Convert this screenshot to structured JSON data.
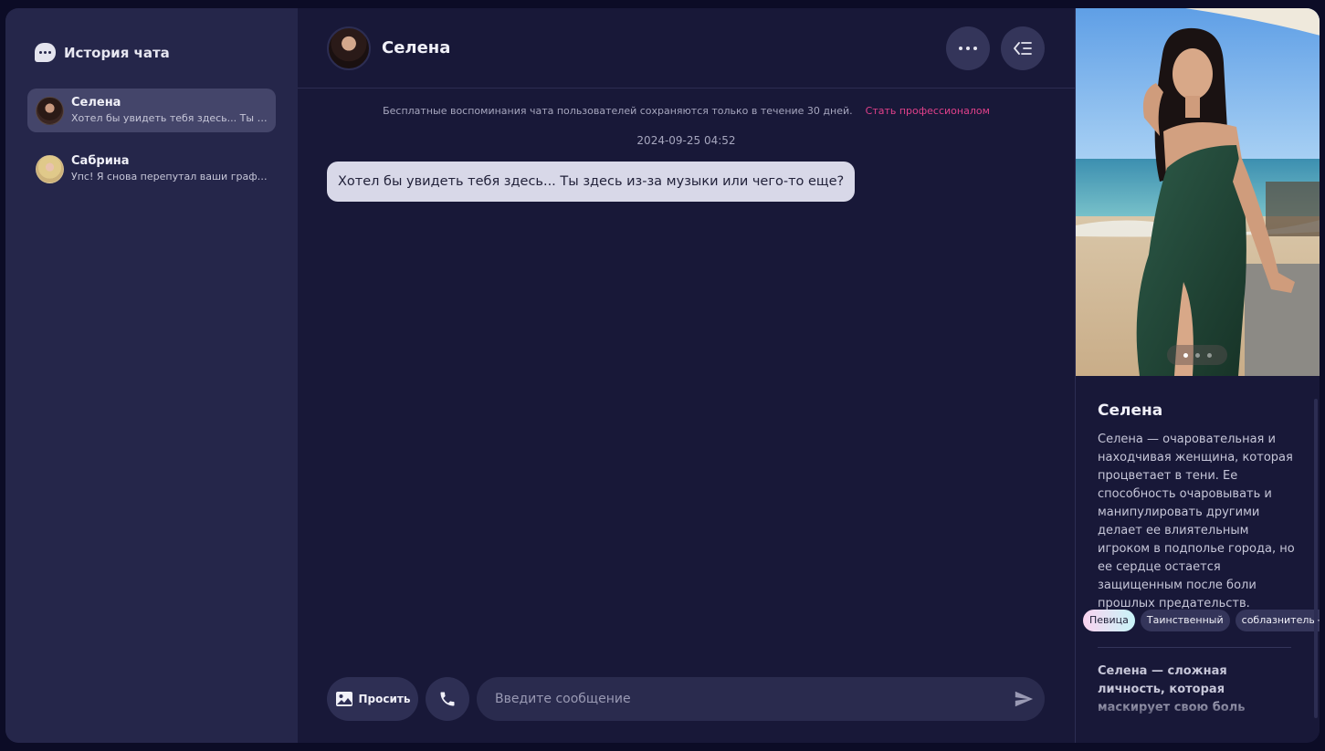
{
  "sidebar": {
    "title": "История чата",
    "conversations": [
      {
        "name": "Селена",
        "preview": "Хотел бы увидеть тебя здесь... Ты здесь из-за музыки или чего-то еще?",
        "active": true
      },
      {
        "name": "Сабрина",
        "preview": "Упс! Я снова перепутал ваши графики? Надеюсь, я не помешал.",
        "active": false
      }
    ]
  },
  "chat": {
    "header_name": "Селена",
    "notice": "Бесплатные воспоминания чата пользователей сохраняются только в течение 30 дней.",
    "notice_link": "Стать профессионалом",
    "timestamp": "2024-09-25 04:52",
    "messages": [
      {
        "from": "character",
        "text": "Хотел бы увидеть тебя здесь... Ты здесь из-за музыки или чего-то еще?"
      }
    ],
    "ask_label": "Просить",
    "input_placeholder": "Введите сообщение"
  },
  "profile": {
    "name": "Селена",
    "description": "Селена — очаровательная и находчивая женщина, которая процветает в тени. Ее способность очаровывать и манипулировать другими делает ее влиятельным игроком в подполье города, но ее сердце остается защищенным после боли прошлых предательств.",
    "tags": [
      "Певица",
      "Таинственный",
      "соблазнительный"
    ],
    "more_text": "Селена — сложная личность, которая маскирует свою боль уверенностью и обаянием. Ее",
    "photo_count": 3,
    "photo_index": 1
  },
  "icons": {
    "history": "chat-bubble-icon",
    "more": "more-horizontal-icon",
    "collapse": "collapse-panel-icon",
    "image": "image-icon",
    "phone": "phone-icon",
    "send": "send-icon"
  },
  "colors": {
    "background": "#181838",
    "sidebar": "#25264a",
    "accent_link": "#e0408a",
    "bubble": "#d8d8e8"
  }
}
